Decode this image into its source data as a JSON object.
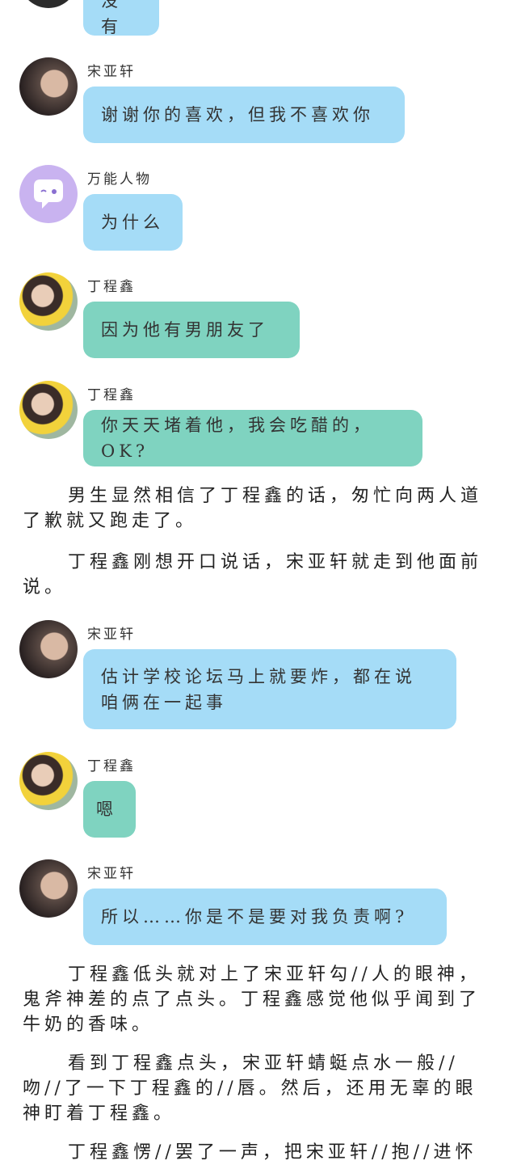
{
  "messages": [
    {
      "speaker": "",
      "text": "没有"
    },
    {
      "speaker": "宋亚轩",
      "text": "谢谢你的喜欢，但我不喜欢你"
    },
    {
      "speaker": "万能人物",
      "text": "为什么"
    },
    {
      "speaker": "丁程鑫",
      "text": "因为他有男朋友了"
    },
    {
      "speaker": "丁程鑫",
      "text": "你天天堵着他，我会吃醋的，OK?"
    },
    {
      "speaker": "宋亚轩",
      "text_line1": "估计学校论坛马上就要炸，都在说",
      "text_line2": "咱俩在一起事"
    },
    {
      "speaker": "丁程鑫",
      "text": "嗯"
    },
    {
      "speaker": "宋亚轩",
      "text": "所以……你是不是要对我负责啊?"
    }
  ],
  "paragraphs": [
    "男生显然相信了丁程鑫的话，匆忙向两人道了歉就又跑走了。",
    "丁程鑫刚想开口说话，宋亚轩就走到他面前说。",
    "丁程鑫低头就对上了宋亚轩勾//人的眼神，鬼斧神差的点了点头。丁程鑫感觉他似乎闻到了牛奶的香味。",
    "看到丁程鑫点头，宋亚轩蜻蜓点水一般//吻//了一下丁程鑫的//唇。然后，还用无辜的眼神盯着丁程鑫。",
    "丁程鑫愣//罢了一声，把宋亚轩//抱//进怀"
  ],
  "colors": {
    "blue_bubble": "#a5dcf7",
    "green_bubble": "#7fd3c0",
    "purple_avatar": "#c9b3f0"
  }
}
